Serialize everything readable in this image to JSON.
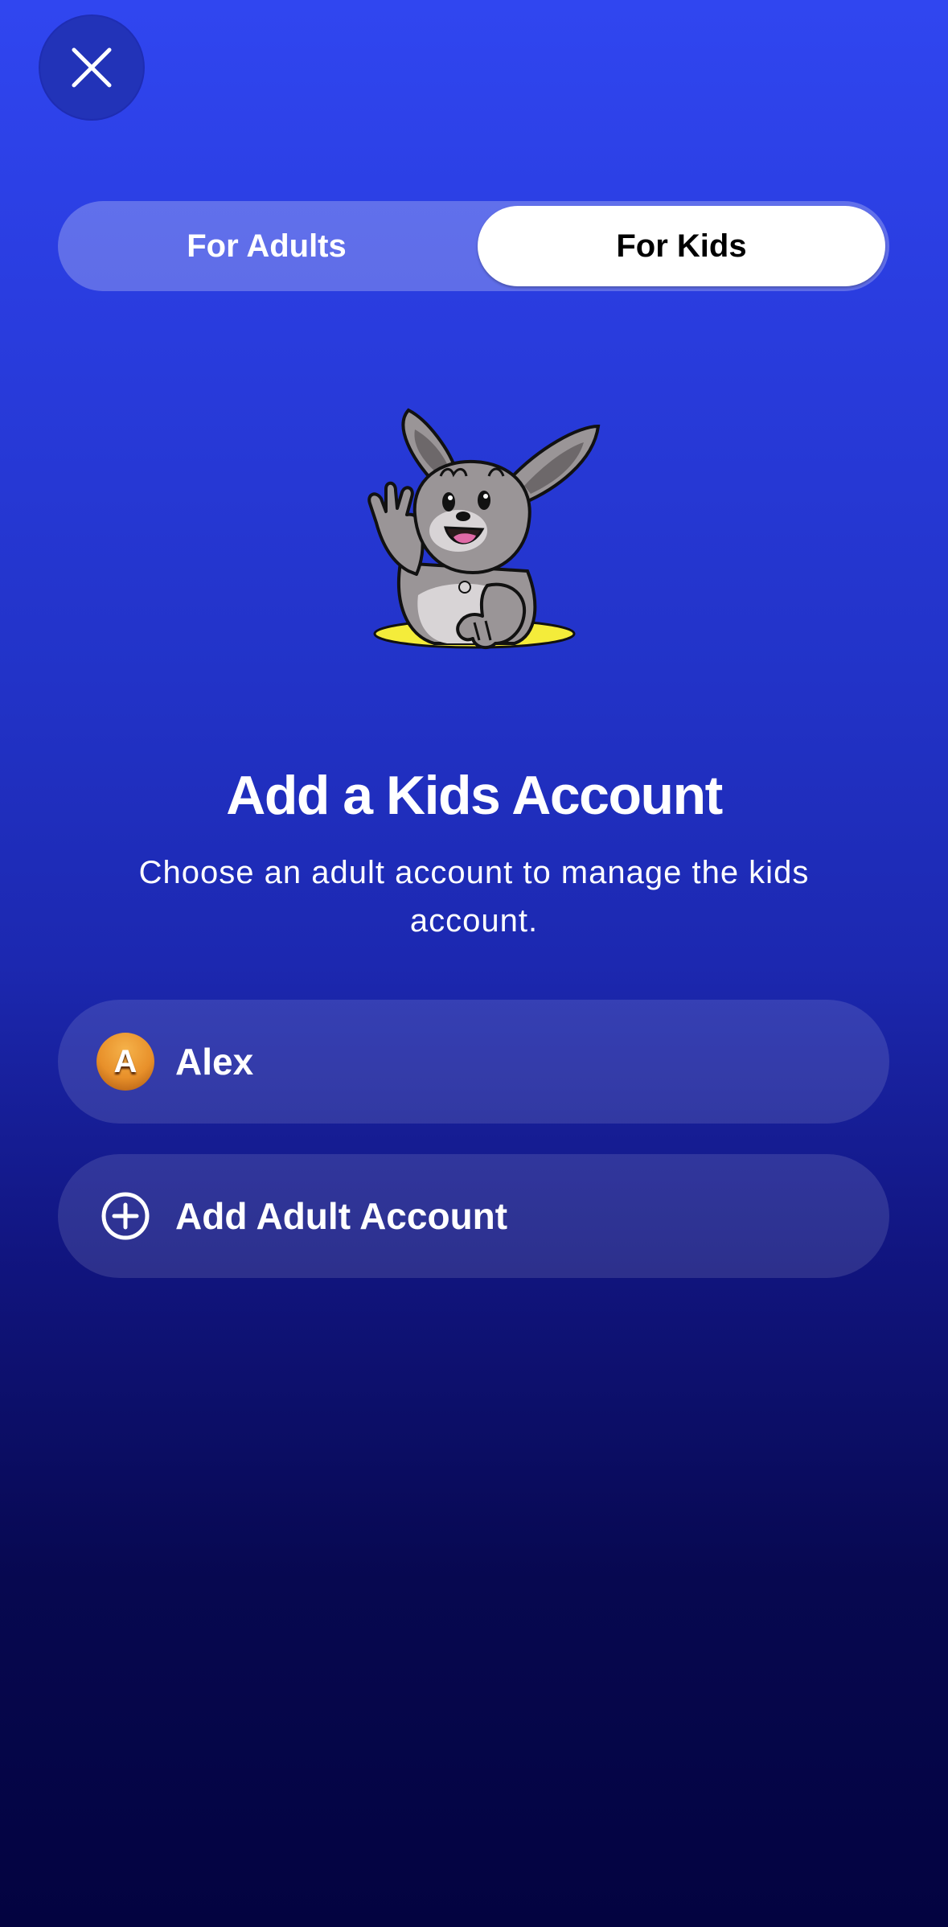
{
  "close": {
    "icon": "close-icon"
  },
  "tabs": [
    {
      "label": "For Adults",
      "selected": false
    },
    {
      "label": "For Kids",
      "selected": true
    }
  ],
  "mascot": {
    "icon": "rabbit-mascot-waving"
  },
  "heading": {
    "title": "Add a Kids Account",
    "subtitle": "Choose an adult account to manage the kids account."
  },
  "accounts": [
    {
      "initial": "A",
      "name": "Alex",
      "avatar_color": "#e8902a"
    }
  ],
  "add_adult": {
    "icon": "plus-circle-icon",
    "label": "Add Adult Account"
  },
  "colors": {
    "background_top": "#3046f0",
    "background_bottom": "#030340",
    "selected_tab": "#ffffff"
  }
}
